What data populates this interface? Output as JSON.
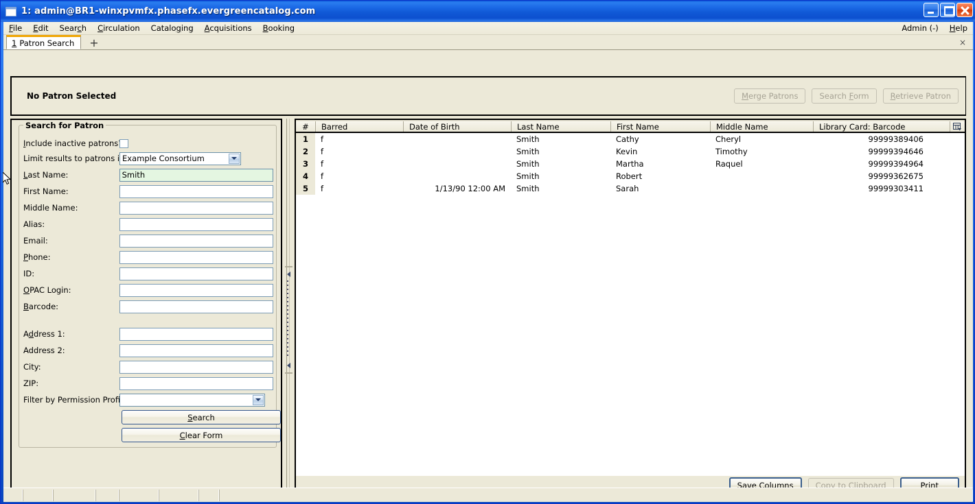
{
  "window": {
    "title": "1: admin@BR1-winxpvmfx.phasefx.evergreencatalog.com",
    "icon": "window-icon",
    "minimize": "minimize-icon",
    "maximize": "maximize-icon",
    "close": "close-icon"
  },
  "menu": {
    "items": [
      {
        "label": "File",
        "accel": "F"
      },
      {
        "label": "Edit",
        "accel": "E"
      },
      {
        "label": "Search",
        "accel": "c"
      },
      {
        "label": "Circulation",
        "accel": "C"
      },
      {
        "label": "Cataloging",
        "accel": "g"
      },
      {
        "label": "Acquisitions",
        "accel": "A"
      },
      {
        "label": "Booking",
        "accel": "B"
      }
    ],
    "right": [
      {
        "label": "Admin (-)"
      },
      {
        "label": "Help"
      }
    ]
  },
  "tabs": {
    "active": {
      "number": "1",
      "label": "Patron Search"
    },
    "new_tab_label": "+",
    "close_label": "×"
  },
  "patron_bar": {
    "status": "No Patron Selected",
    "buttons": [
      {
        "label": "Merge Patrons",
        "enabled": false
      },
      {
        "label": "Search Form",
        "enabled": false
      },
      {
        "label": "Retrieve Patron",
        "enabled": false
      }
    ]
  },
  "search_form": {
    "legend": "Search for Patron",
    "include_inactive": {
      "label": "Include inactive patrons?",
      "checked": false
    },
    "limit_results": {
      "label": "Limit results to patrons in",
      "value": "Example Consortium"
    },
    "fields": [
      {
        "label": "Last Name:",
        "value": "Smith",
        "placeholder": "",
        "focused": true
      },
      {
        "label": "First Name:",
        "value": "",
        "placeholder": "",
        "focused": false
      },
      {
        "label": "Middle Name:",
        "value": "",
        "placeholder": "",
        "focused": false
      },
      {
        "label": "Alias:",
        "value": "",
        "placeholder": "",
        "focused": false
      },
      {
        "label": "Email:",
        "value": "",
        "placeholder": "",
        "focused": false
      },
      {
        "label": "Phone:",
        "value": "",
        "placeholder": "",
        "focused": false
      },
      {
        "label": "ID:",
        "value": "",
        "placeholder": "",
        "focused": false
      },
      {
        "label": "OPAC Login:",
        "value": "",
        "placeholder": "",
        "focused": false
      },
      {
        "label": "Barcode:",
        "value": "",
        "placeholder": "",
        "focused": false
      },
      {
        "label": "Address 1:",
        "value": "",
        "placeholder": "",
        "focused": false
      },
      {
        "label": "Address 2:",
        "value": "",
        "placeholder": "",
        "focused": false
      },
      {
        "label": "City:",
        "value": "",
        "placeholder": "",
        "focused": false
      },
      {
        "label": "ZIP:",
        "value": "",
        "placeholder": "",
        "focused": false
      }
    ],
    "permission_profile": {
      "label": "Filter by Permission Profile:",
      "value": ""
    },
    "search_button": "Search",
    "clear_button": "Clear Form"
  },
  "results": {
    "columns": [
      "#",
      "Barred",
      "Date of Birth",
      "Last Name",
      "First Name",
      "Middle Name",
      "Library Card: Barcode"
    ],
    "column_picker_icon": "column-picker-icon",
    "rows": [
      {
        "n": "1",
        "barred": "f",
        "dob": "",
        "last": "Smith",
        "first": "Cathy",
        "middle": "Cheryl",
        "barcode": "99999389406"
      },
      {
        "n": "2",
        "barred": "f",
        "dob": "",
        "last": "Smith",
        "first": "Kevin",
        "middle": "Timothy",
        "barcode": "99999394646"
      },
      {
        "n": "3",
        "barred": "f",
        "dob": "",
        "last": "Smith",
        "first": "Martha",
        "middle": "Raquel",
        "barcode": "99999394964"
      },
      {
        "n": "4",
        "barred": "f",
        "dob": "",
        "last": "Smith",
        "first": "Robert",
        "middle": "",
        "barcode": "99999362675"
      },
      {
        "n": "5",
        "barred": "f",
        "dob": "1/13/90 12:00 AM",
        "last": "Smith",
        "first": "Sarah",
        "middle": "",
        "barcode": "99999303411"
      }
    ],
    "footer_buttons": [
      {
        "label": "Save Columns",
        "enabled": true,
        "default": false
      },
      {
        "label": "Copy to Clipboard",
        "enabled": false,
        "default": false
      },
      {
        "label": "Print",
        "enabled": true,
        "default": true
      }
    ]
  },
  "colors": {
    "titlebar_blue": "#1760d8",
    "window_face": "#ece9d8",
    "tab_accent": "#f0a500",
    "field_focus_green": "#e4f6e1",
    "grid_white": "#ffffff"
  }
}
